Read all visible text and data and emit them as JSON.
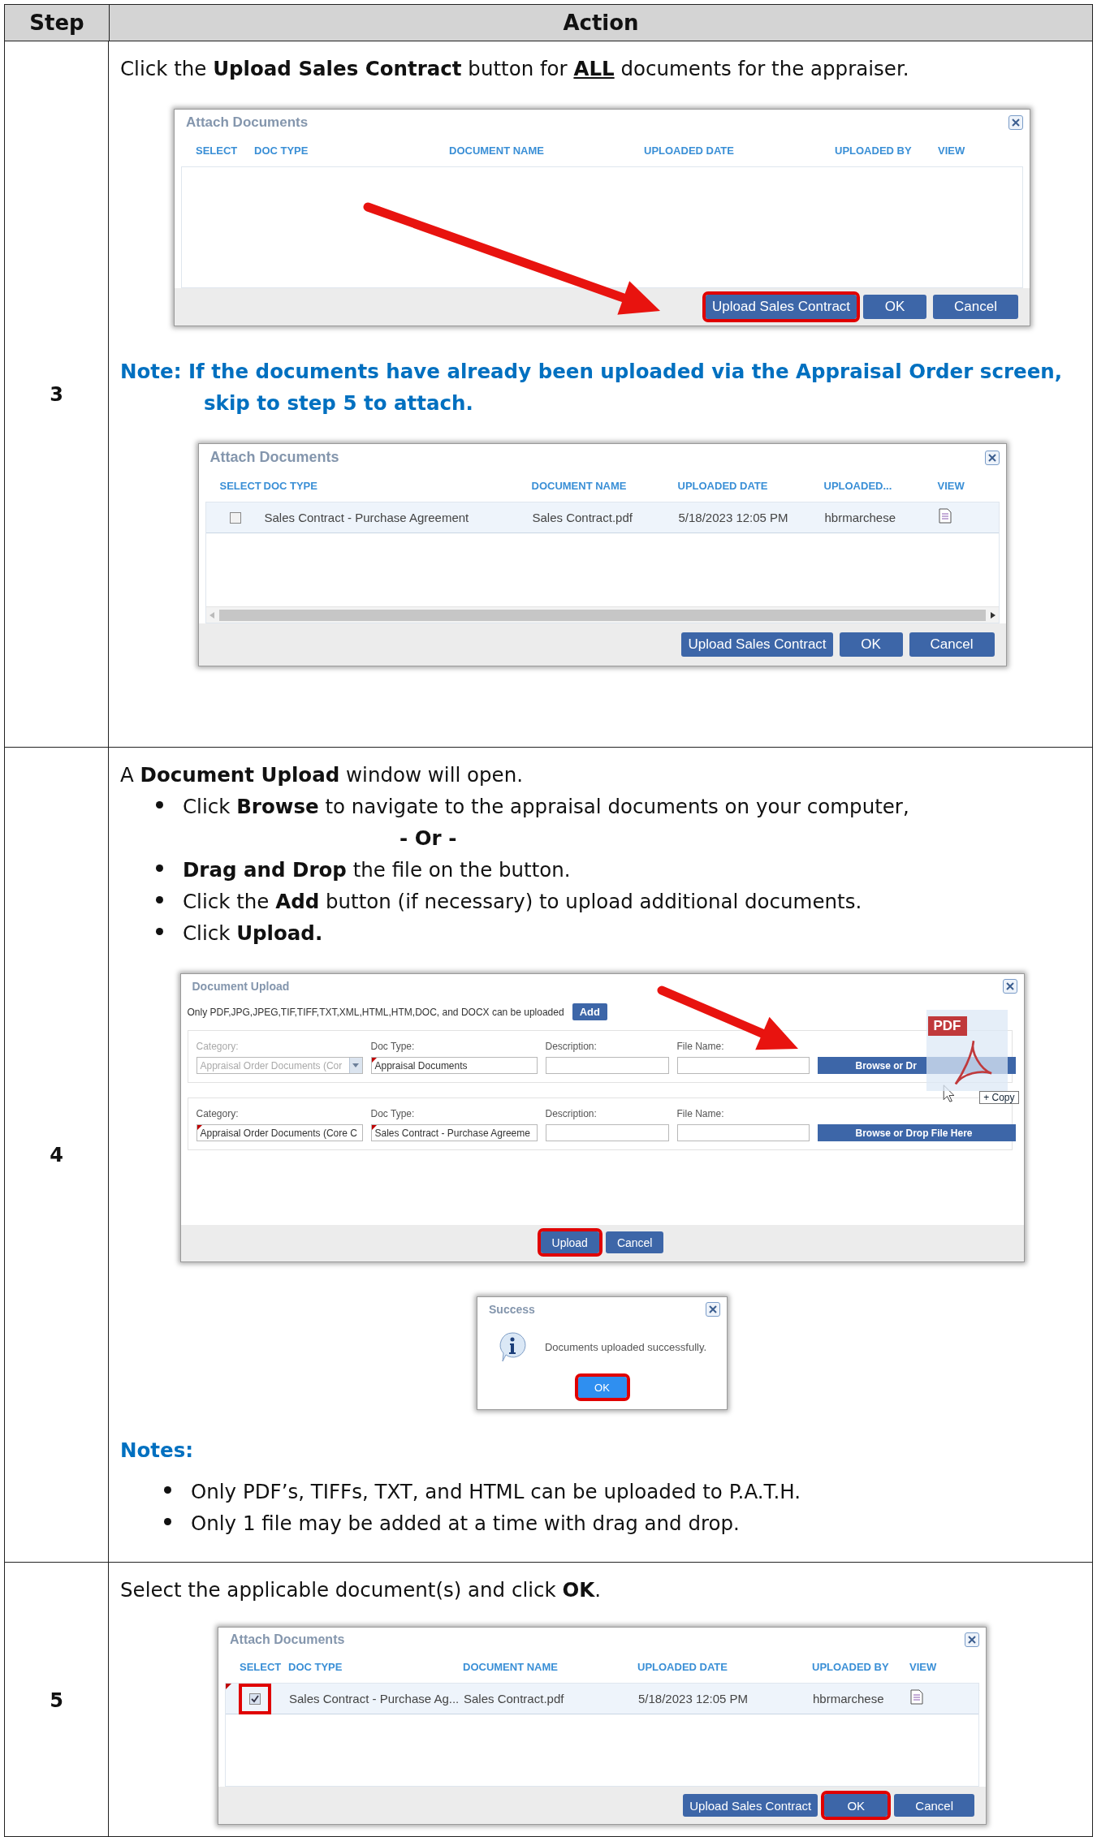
{
  "table": {
    "columns": [
      "Step",
      "Action"
    ],
    "rows": [
      {
        "step": "3",
        "blocks": [
          {
            "kind": "text",
            "segments": [
              {
                "text": "Click the "
              },
              {
                "text": "Upload Sales Contract",
                "bold": true
              },
              {
                "text": " button for "
              },
              {
                "text": "ALL",
                "bold": true,
                "underline": true
              },
              {
                "text": " documents for the appraiser."
              }
            ]
          },
          {
            "kind": "attach_dialog",
            "title": "Attach Documents",
            "arrow": true,
            "scrollbar": false,
            "columns": [
              "SELECT",
              "DOC TYPE",
              "DOCUMENT NAME",
              "UPLOADED DATE",
              "UPLOADED BY",
              "VIEW"
            ],
            "buttons": [
              {
                "label": "Upload Sales Contract",
                "highlighted": true
              },
              {
                "label": "OK",
                "highlighted": false
              },
              {
                "label": "Cancel",
                "highlighted": false
              }
            ]
          },
          {
            "kind": "note",
            "text": "Note: If the documents have already been uploaded via the Appraisal Order screen, skip to step 5 to attach."
          },
          {
            "kind": "attach_dialog",
            "title": "Attach Documents",
            "arrow": false,
            "scrollbar": true,
            "columns": [
              "SELECT",
              "DOC TYPE",
              "DOCUMENT NAME",
              "UPLOADED DATE",
              "UPLOADED...",
              "VIEW"
            ],
            "rows": [
              {
                "checked": false,
                "highlighted": false,
                "flagged": false,
                "doc_type": "Sales Contract - Purchase Agreement",
                "document_name": "Sales Contract.pdf",
                "uploaded_date": "5/18/2023 12:05 PM",
                "uploaded_by": "hbrmarchese"
              }
            ],
            "buttons": [
              {
                "label": "Upload Sales Contract",
                "highlighted": false
              },
              {
                "label": "OK",
                "highlighted": false
              },
              {
                "label": "Cancel",
                "highlighted": false
              }
            ]
          }
        ]
      },
      {
        "step": "4",
        "blocks": [
          {
            "kind": "text",
            "segments": [
              {
                "text": "A "
              },
              {
                "text": "Document Upload",
                "bold": true
              },
              {
                "text": " window will open."
              }
            ]
          },
          {
            "kind": "list",
            "items": [
              {
                "kind": "bullet",
                "segments": [
                  {
                    "text": "Click "
                  },
                  {
                    "text": "Browse",
                    "bold": true
                  },
                  {
                    "text": " to navigate to the appraisal documents on your computer,"
                  }
                ]
              },
              {
                "kind": "separator",
                "segments": [
                  {
                    "text": "- Or -",
                    "bold": true
                  }
                ]
              },
              {
                "kind": "bullet",
                "segments": [
                  {
                    "text": "Drag and Drop",
                    "bold": true
                  },
                  {
                    "text": " the file on the button."
                  }
                ]
              },
              {
                "kind": "bullet",
                "segments": [
                  {
                    "text": "Click the "
                  },
                  {
                    "text": "Add",
                    "bold": true
                  },
                  {
                    "text": " button (if necessary) to upload additional documents."
                  }
                ]
              },
              {
                "kind": "bullet",
                "segments": [
                  {
                    "text": "Click "
                  },
                  {
                    "text": "Upload.",
                    "bold": true
                  }
                ]
              }
            ]
          },
          {
            "kind": "upload_dialog",
            "title": "Document Upload",
            "arrow": true,
            "info": "Only PDF,JPG,JPEG,TIF,TIFF,TXT,XML,HTML,HTM,DOC, and DOCX can be uploaded",
            "add_button": "Add",
            "file_rows": [
              {
                "category_label": "Category:",
                "category": "Appraisal Order Documents (Cor",
                "category_disabled": true,
                "doc_type_label": "Doc Type:",
                "doc_type": "Appraisal Documents",
                "description_label": "Description:",
                "file_name_label": "File Name:",
                "browse_button": "Browse or Dr",
                "dragging": true
              },
              {
                "category_label": "Category:",
                "category": "Appraisal Order Documents (Core C",
                "category_disabled": false,
                "doc_type_label": "Doc Type:",
                "doc_type": "Sales Contract - Purchase Agreeme",
                "description_label": "Description:",
                "file_name_label": "File Name:",
                "browse_button": "Browse or Drop File Here",
                "dragging": false
              }
            ],
            "drag_file_label": "PDF",
            "drag_action": "+ Copy",
            "buttons": [
              {
                "label": "Upload",
                "highlighted": true
              },
              {
                "label": "Cancel",
                "highlighted": false
              }
            ]
          },
          {
            "kind": "success_dialog",
            "title": "Success",
            "message": "Documents uploaded successfully.",
            "button": {
              "label": "OK",
              "highlighted": true
            }
          },
          {
            "kind": "heading",
            "text": "Notes:"
          },
          {
            "kind": "list",
            "items": [
              {
                "kind": "bullet",
                "segments": [
                  {
                    "text": "Only PDF’s, TIFFs, TXT, and HTML can be uploaded to P.A.T.H."
                  }
                ]
              },
              {
                "kind": "bullet",
                "segments": [
                  {
                    "text": "Only 1 file may be added at a time with drag and drop."
                  }
                ]
              }
            ]
          }
        ]
      },
      {
        "step": "5",
        "blocks": [
          {
            "kind": "text",
            "segments": [
              {
                "text": "Select the applicable document(s) and click "
              },
              {
                "text": "OK",
                "bold": true
              },
              {
                "text": "."
              }
            ]
          },
          {
            "kind": "attach_dialog",
            "title": "Attach Documents",
            "arrow": false,
            "scrollbar": false,
            "columns": [
              "SELECT",
              "DOC TYPE",
              "DOCUMENT NAME",
              "UPLOADED DATE",
              "UPLOADED BY",
              "VIEW"
            ],
            "rows": [
              {
                "checked": true,
                "highlighted": true,
                "flagged": true,
                "doc_type": "Sales Contract - Purchase Ag...",
                "document_name": "Sales Contract.pdf",
                "uploaded_date": "5/18/2023 12:05 PM",
                "uploaded_by": "hbrmarchese"
              }
            ],
            "buttons": [
              {
                "label": "Upload Sales Contract",
                "highlighted": false
              },
              {
                "label": "OK",
                "highlighted": true
              },
              {
                "label": "Cancel",
                "highlighted": false
              }
            ]
          }
        ]
      }
    ]
  }
}
